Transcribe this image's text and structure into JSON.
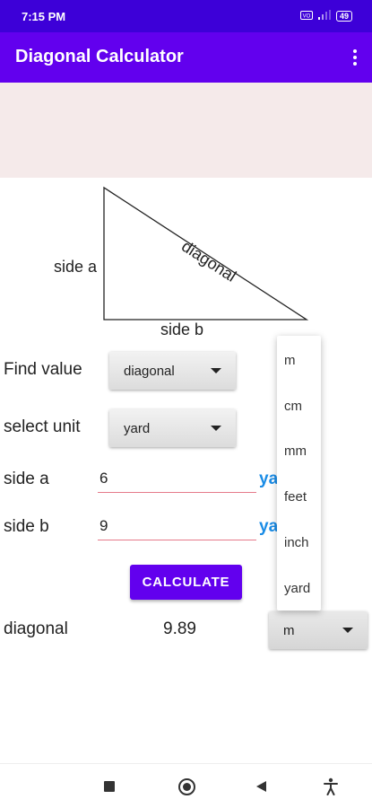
{
  "status_bar": {
    "time": "7:15 PM",
    "icons": [
      "vpn-icon",
      "signal-icon",
      "battery-icon"
    ],
    "battery_level": "49"
  },
  "app_bar": {
    "title": "Diagonal Calculator",
    "overflow_icon": "more-vert-icon"
  },
  "diagram": {
    "side_a_label": "side a",
    "side_b_label": "side b",
    "diagonal_label": "diagonal"
  },
  "form": {
    "find_value_label": "Find value",
    "find_value_selected": "diagonal",
    "select_unit_label": "select unit",
    "select_unit_selected": "yard",
    "side_a_label": "side a",
    "side_a_value": "6",
    "side_a_unit": "ya",
    "side_b_label": "side b",
    "side_b_value": "9",
    "side_b_unit": "ya",
    "calculate_label": "CALCULATE"
  },
  "result": {
    "label": "diagonal",
    "value": "9.89",
    "unit_selected": "m"
  },
  "unit_dropdown": {
    "options": [
      "m",
      "cm",
      "mm",
      "feet",
      "inch",
      "yard"
    ]
  },
  "nav_bar": {
    "icons": [
      "recents-icon",
      "home-icon",
      "back-icon",
      "accessibility-icon"
    ]
  },
  "colors": {
    "status_bar": "#3d00d8",
    "app_bar": "#6200ee",
    "accent_text": "#1a8ce6",
    "input_underline": "#e57a8a",
    "ad_background": "#f5eaea"
  }
}
